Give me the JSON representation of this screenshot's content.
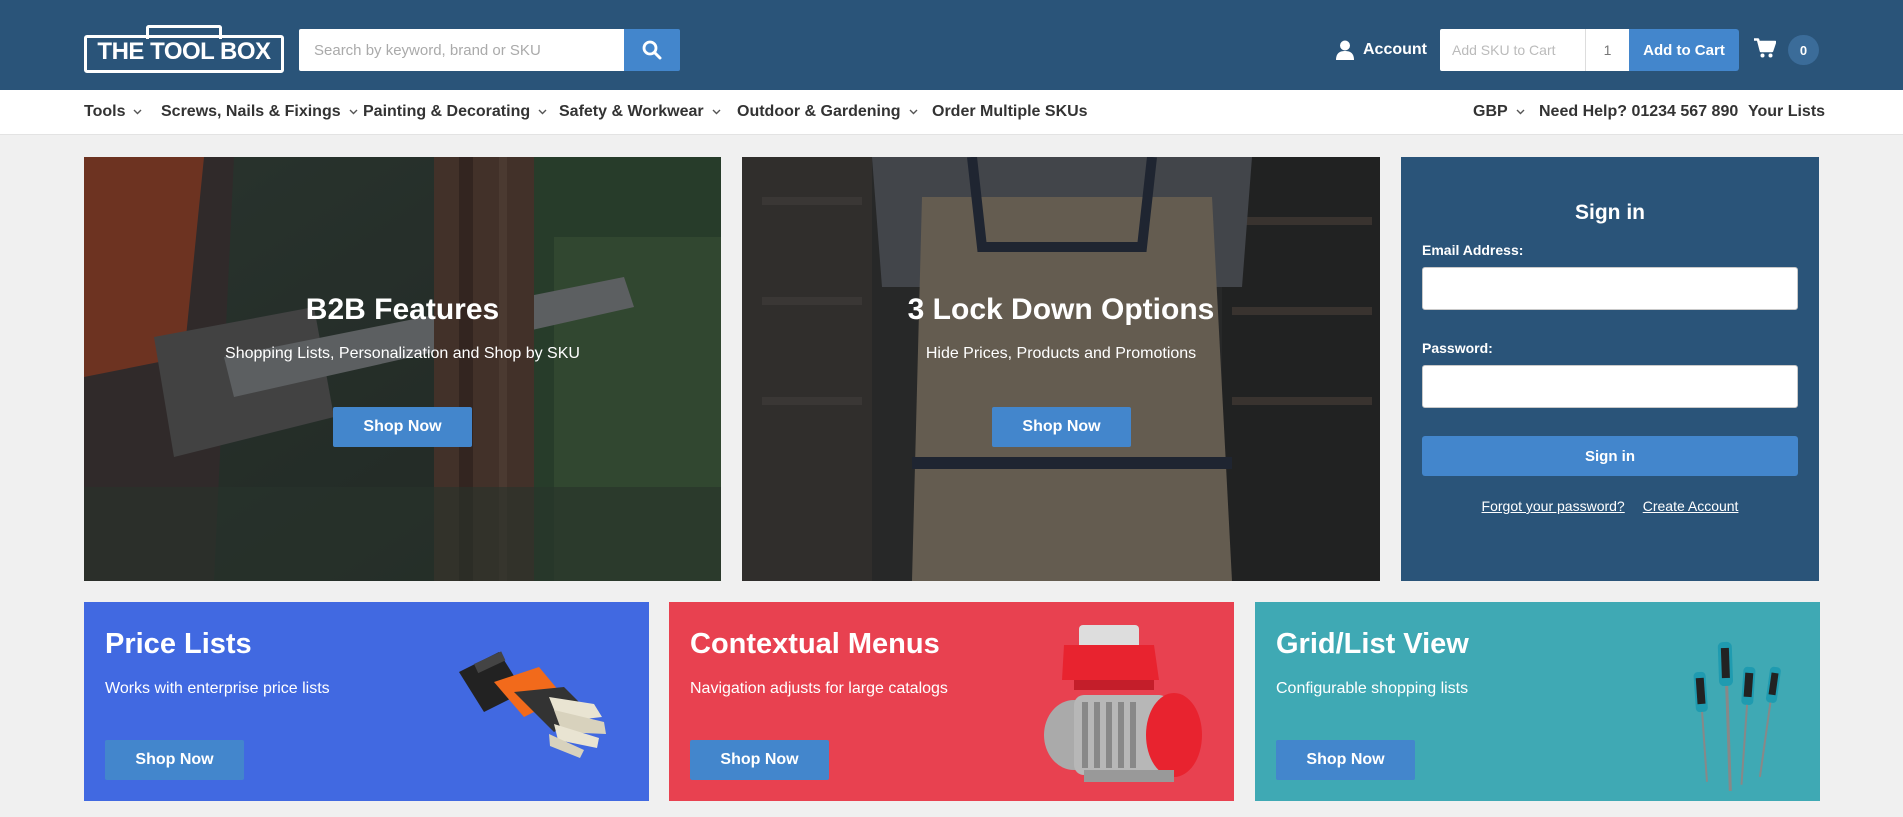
{
  "header": {
    "logo_text": "THE TOOL BOX",
    "search_placeholder": "Search by keyword, brand or SKU",
    "account_label": "Account",
    "sku_placeholder": "Add SKU to Cart",
    "qty_value": "1",
    "add_to_cart_label": "Add to Cart",
    "cart_count": "0"
  },
  "nav": {
    "items": [
      {
        "label": "Tools"
      },
      {
        "label": "Screws, Nails & Fixings"
      },
      {
        "label": "Painting & Decorating"
      },
      {
        "label": "Safety & Workwear"
      },
      {
        "label": "Outdoor & Gardening"
      },
      {
        "label": "Order Multiple SKUs"
      }
    ],
    "currency": "GBP",
    "help": "Need Help? 01234 567 890",
    "your_lists": "Your Lists"
  },
  "hero": [
    {
      "title": "B2B Features",
      "subtitle": "Shopping Lists, Personalization and Shop by SKU",
      "button": "Shop Now"
    },
    {
      "title": "3 Lock Down Options",
      "subtitle": "Hide Prices, Products and Promotions",
      "button": "Shop Now"
    }
  ],
  "signin": {
    "title": "Sign in",
    "email_label": "Email Address:",
    "password_label": "Password:",
    "button": "Sign in",
    "forgot": "Forgot your password?",
    "create": "Create Account"
  },
  "tiles": [
    {
      "title": "Price Lists",
      "subtitle": "Works with enterprise price lists",
      "button": "Shop Now",
      "color": "#4169e1"
    },
    {
      "title": "Contextual Menus",
      "subtitle": "Navigation adjusts for large catalogs",
      "button": "Shop Now",
      "color": "#e84150"
    },
    {
      "title": "Grid/List View",
      "subtitle": "Configurable shopping lists",
      "button": "Shop Now",
      "color": "#3fa9b4"
    }
  ],
  "colors": {
    "header_bg": "#2a5479",
    "accent": "#4386cc",
    "page_bg": "#f0f0f0"
  }
}
